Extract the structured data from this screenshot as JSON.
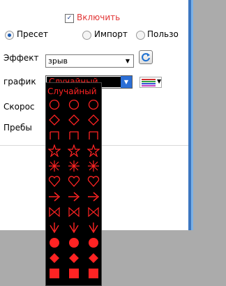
{
  "enable": {
    "label": "Включить",
    "checked": true
  },
  "source": {
    "options": [
      {
        "label": "Пресет",
        "selected": true
      },
      {
        "label": "Импорт",
        "selected": false
      },
      {
        "label": "Пользо",
        "selected": false
      }
    ]
  },
  "effect": {
    "label": "Эффект",
    "value": "зрыв"
  },
  "graphic": {
    "label": "график",
    "value": "Случайный",
    "swatch_colors": [
      "#d03030",
      "#30a040",
      "#3050d0",
      "#c040c0"
    ]
  },
  "speed": {
    "label": "Скорос"
  },
  "stay": {
    "label": "Пребы"
  },
  "dropdown": {
    "header": "Случайный",
    "shapes": [
      "circle",
      "diamond",
      "square",
      "star",
      "burst",
      "heart",
      "arrow",
      "bowtie",
      "lotus",
      "dot",
      "filled-diamond",
      "filled-square"
    ]
  },
  "colors": {
    "accent": "#ff2323",
    "panel_border": "#3b76c0"
  }
}
